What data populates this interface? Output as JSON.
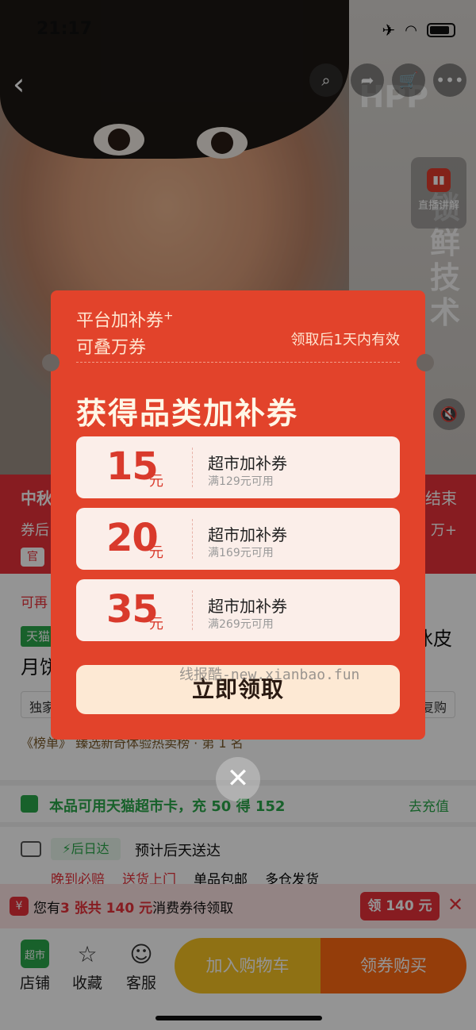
{
  "status": {
    "time": "21:17"
  },
  "hero_text": {
    "letters": "HPP",
    "vertical": "锁鲜技术"
  },
  "nav": {
    "back": "‹",
    "icons": [
      "search-icon",
      "share-icon",
      "cart-icon",
      "more-icon"
    ]
  },
  "live": {
    "label": "直播讲解"
  },
  "promo": {
    "left1": "中秋",
    "right1": "结束",
    "left2": "券后",
    "right2": "万+",
    "tag": "官"
  },
  "info": {
    "row1": "可再",
    "tag": "天猫",
    "title_right": "冰皮",
    "title_left": "月饼",
    "exclusive_left": "独家",
    "exclusive_right": "人复购",
    "rank": "《榜单》 臻选新奇体验热卖榜 · 第 1 名"
  },
  "card": {
    "text": "本品可用天猫超市卡，充 50 得 152",
    "action": "去充值"
  },
  "shipping": {
    "badge": "⚡后日达",
    "text": "预计后天送达",
    "tags": [
      "晚到必赔",
      "送货上门",
      "单品包邮",
      "多仓发货"
    ]
  },
  "coupon_bar": {
    "prefix": "您有",
    "highlight": "3 张共 140 元",
    "suffix": "消费券待领取",
    "button": "领 140 元",
    "close": "✕"
  },
  "bottom": {
    "shop_badge": "超市",
    "shop": "店铺",
    "favorite": "收藏",
    "service": "客服",
    "add_cart": "加入购物车",
    "buy": "领券购买"
  },
  "modal": {
    "header_a": "平台加补券",
    "header_a_sup": "+",
    "header_b": "可叠万券",
    "validity": "领取后1天内有效",
    "title": "获得品类加补券",
    "coupons": [
      {
        "amount": "15",
        "unit": "元",
        "name": "超市加补券",
        "condition": "满129元可用"
      },
      {
        "amount": "20",
        "unit": "元",
        "name": "超市加补券",
        "condition": "满169元可用"
      },
      {
        "amount": "35",
        "unit": "元",
        "name": "超市加补券",
        "condition": "满269元可用"
      }
    ],
    "claim_button": "立即领取",
    "watermark": "线报酷-new.xianbao.fun",
    "close": "✕"
  }
}
